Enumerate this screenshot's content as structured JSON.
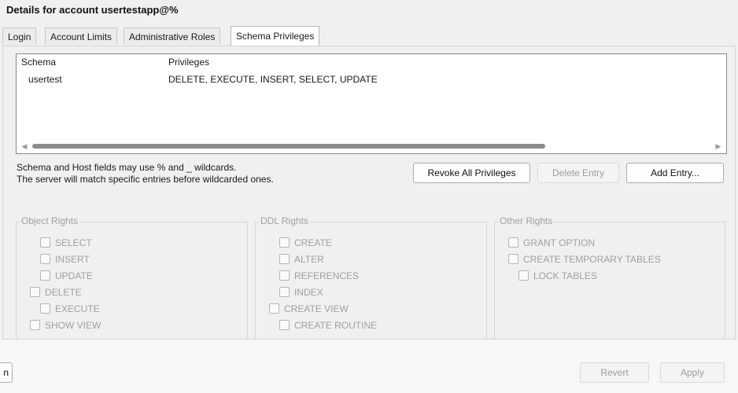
{
  "title": "Details for account usertestapp@%",
  "tabs": [
    {
      "label": "Login"
    },
    {
      "label": "Account Limits"
    },
    {
      "label": "Administrative Roles"
    },
    {
      "label": "Schema Privileges",
      "active": true
    }
  ],
  "table": {
    "headers": [
      "Schema",
      "Privileges"
    ],
    "rows": [
      {
        "schema": "usertest",
        "privileges": "DELETE, EXECUTE, INSERT, SELECT, UPDATE"
      }
    ]
  },
  "hint": {
    "line1": "Schema and Host fields may use % and _ wildcards.",
    "line2": "The server will match specific entries before wildcarded ones."
  },
  "buttons": {
    "revoke_all": "Revoke All Privileges",
    "delete_entry": "Delete Entry",
    "add_entry": "Add Entry...",
    "partial_left": "n",
    "revert": "Revert",
    "apply": "Apply"
  },
  "groups": {
    "object_rights": {
      "title": "Object Rights",
      "items": [
        "SELECT",
        "INSERT",
        "UPDATE",
        "DELETE",
        "EXECUTE",
        "SHOW VIEW"
      ]
    },
    "ddl_rights": {
      "title": "DDL Rights",
      "items": [
        "CREATE",
        "ALTER",
        "REFERENCES",
        "INDEX",
        "CREATE VIEW",
        "CREATE ROUTINE"
      ]
    },
    "other_rights": {
      "title": "Other Rights",
      "items": [
        "GRANT OPTION",
        "CREATE TEMPORARY TABLES",
        "LOCK TABLES"
      ]
    }
  },
  "colors": {
    "disabled_text": "#a0a0a0",
    "scroll_thumb": "#8c8c8c"
  }
}
